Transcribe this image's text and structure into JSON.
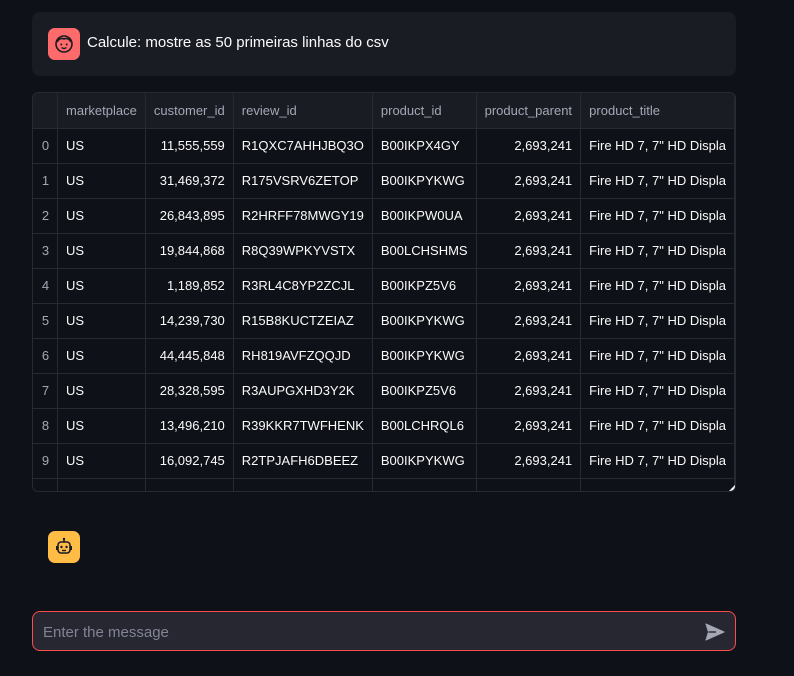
{
  "user_message": {
    "avatar_icon": "user-face-icon",
    "avatar_color": "#ff6b6b",
    "text": "Calcule: mostre as 50 primeiras linhas do csv"
  },
  "table": {
    "columns": [
      "",
      "marketplace",
      "customer_id",
      "review_id",
      "product_id",
      "product_parent",
      "product_title"
    ],
    "rows": [
      [
        "0",
        "US",
        "11,555,559",
        "R1QXC7AHHJBQ3O",
        "B00IKPX4GY",
        "2,693,241",
        "Fire HD 7, 7\" HD Displa"
      ],
      [
        "1",
        "US",
        "31,469,372",
        "R175VSRV6ZETOP",
        "B00IKPYKWG",
        "2,693,241",
        "Fire HD 7, 7\" HD Displa"
      ],
      [
        "2",
        "US",
        "26,843,895",
        "R2HRFF78MWGY19",
        "B00IKPW0UA",
        "2,693,241",
        "Fire HD 7, 7\" HD Displa"
      ],
      [
        "3",
        "US",
        "19,844,868",
        "R8Q39WPKYVSTX",
        "B00LCHSHMS",
        "2,693,241",
        "Fire HD 7, 7\" HD Displa"
      ],
      [
        "4",
        "US",
        "1,189,852",
        "R3RL4C8YP2ZCJL",
        "B00IKPZ5V6",
        "2,693,241",
        "Fire HD 7, 7\" HD Displa"
      ],
      [
        "5",
        "US",
        "14,239,730",
        "R15B8KUCTZEIAZ",
        "B00IKPYKWG",
        "2,693,241",
        "Fire HD 7, 7\" HD Displa"
      ],
      [
        "6",
        "US",
        "44,445,848",
        "RH819AVFZQQJD",
        "B00IKPYKWG",
        "2,693,241",
        "Fire HD 7, 7\" HD Displa"
      ],
      [
        "7",
        "US",
        "28,328,595",
        "R3AUPGXHD3Y2K",
        "B00IKPZ5V6",
        "2,693,241",
        "Fire HD 7, 7\" HD Displa"
      ],
      [
        "8",
        "US",
        "13,496,210",
        "R39KKR7TWFHENK",
        "B00LCHRQL6",
        "2,693,241",
        "Fire HD 7, 7\" HD Displa"
      ],
      [
        "9",
        "US",
        "16,092,745",
        "R2TPJAFH6DBEEZ",
        "B00IKPYKWG",
        "2,693,241",
        "Fire HD 7, 7\" HD Displa"
      ]
    ]
  },
  "assistant_message": {
    "avatar_icon": "robot-icon",
    "avatar_color": "#ffbd45"
  },
  "chat_input": {
    "placeholder": "Enter the message",
    "value": "",
    "send_icon": "send-icon",
    "border_color": "#ff4b4b"
  }
}
